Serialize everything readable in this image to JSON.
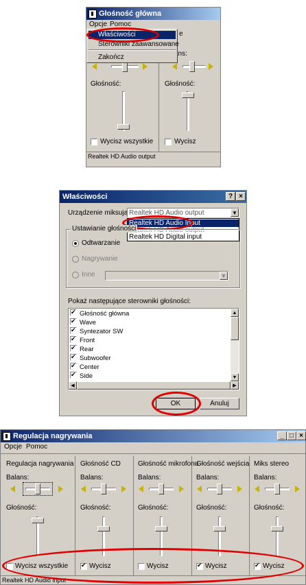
{
  "window1": {
    "title": "Głośność główna",
    "menu": [
      "Opcje",
      "Pomoc"
    ],
    "dropdown_items": [
      "Właściwości",
      "Sterowniki zaawansowane",
      "Zakończ"
    ],
    "partial_text": "e",
    "balans_label": "ans:",
    "glosnosc_label_1": "Głośność:",
    "glosnosc_label_2": "Głośność:",
    "mute_all_label": "Wycisz wszystkie",
    "mute_label": "Wycisz",
    "status": "Realtek HD Audio output"
  },
  "window2": {
    "title": "Właściwości",
    "help_btn": "?",
    "close_btn": "×",
    "device_label": "Urządzenie miksujące:",
    "device_value": "Realtek HD Audio output",
    "device_options": [
      "Realtek HD Audio output",
      "Realtek HD Audio Input",
      "Realtek HD Digital input"
    ],
    "adjust_group_label": "Ustawianie głośności",
    "radio_playback": "Odtwarzanie",
    "radio_recording": "Nagrywanie",
    "radio_other": "Inne",
    "show_controls_label": "Pokaż następujące sterowniki głośności:",
    "controls": [
      "Głośność główna",
      "Wave",
      "Syntezator SW",
      "Front",
      "Rear",
      "Subwoofer",
      "Center",
      "Side"
    ],
    "ok_label": "OK",
    "cancel_label": "Anuluj"
  },
  "window3": {
    "title": "Regulacja nagrywania",
    "menu": [
      "Opcje",
      "Pomoc"
    ],
    "columns": [
      {
        "name": "Regulacja nagrywania",
        "mute_label": "Wycisz wszystkie",
        "muted": false
      },
      {
        "name": "Głośność CD",
        "mute_label": "Wycisz",
        "muted": true
      },
      {
        "name": "Głośność mikrofonu",
        "mute_label": "Wycisz",
        "muted": false
      },
      {
        "name": "Głośność wejścia",
        "mute_label": "Wycisz",
        "muted": true
      },
      {
        "name": "Miks stereo",
        "mute_label": "Wycisz",
        "muted": true
      }
    ],
    "balans_label": "Balans:",
    "glosnosc_label": "Głośność:",
    "status": "Realtek HD Audio input"
  },
  "colors": {
    "titlebar": "#0a246a",
    "highlight": "#e00000",
    "face": "#d4d0c8"
  }
}
